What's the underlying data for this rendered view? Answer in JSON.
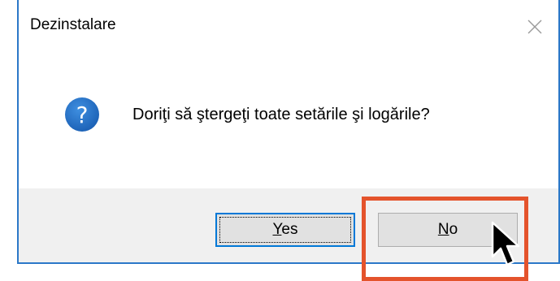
{
  "window": {
    "title": "Dezinstalare"
  },
  "dialog": {
    "message": "Doriţi să ştergeţi toate setările şi logările?",
    "icon": "question-icon"
  },
  "buttons": {
    "yes_mnemonic": "Y",
    "yes_rest": "es",
    "no_mnemonic": "N",
    "no_rest": "o"
  },
  "colors": {
    "highlight": "#e4532c",
    "icon_blue": "#1f6fc5",
    "focus_border": "#0078d7",
    "footer_bg": "#f0f0f0"
  }
}
